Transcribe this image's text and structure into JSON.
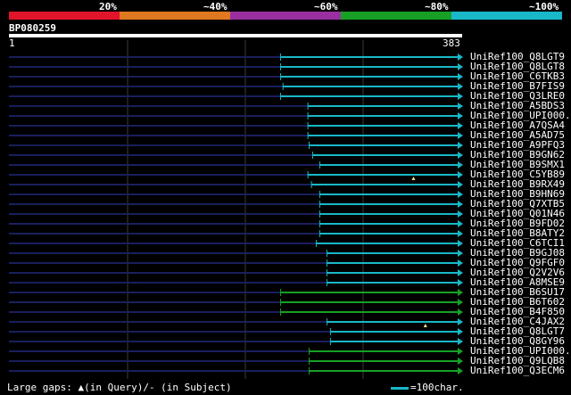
{
  "legend": [
    {
      "label": "20%",
      "color": "#e0142a"
    },
    {
      "label": "~40%",
      "color": "#e07820"
    },
    {
      "label": "~60%",
      "color": "#9a2fa0"
    },
    {
      "label": "~80%",
      "color": "#17a025"
    },
    {
      "label": "~100%",
      "color": "#18b8c8"
    }
  ],
  "query": {
    "name": "BP080259",
    "start": "1",
    "end": "383"
  },
  "hits": [
    {
      "name": "UniRef100_Q8LGT9",
      "start": 230,
      "color": "#18b8c8"
    },
    {
      "name": "UniRef100_Q8LGT8",
      "start": 230,
      "color": "#18b8c8"
    },
    {
      "name": "UniRef100_C6TKB3",
      "start": 230,
      "color": "#18b8c8"
    },
    {
      "name": "UniRef100_B7FIS9",
      "start": 232,
      "color": "#18b8c8"
    },
    {
      "name": "UniRef100_Q3LRE0",
      "start": 230,
      "color": "#18b8c8"
    },
    {
      "name": "UniRef100_A5BDS3",
      "start": 253,
      "color": "#18b8c8"
    },
    {
      "name": "UniRef100_UPI000..",
      "start": 253,
      "color": "#18b8c8"
    },
    {
      "name": "UniRef100_A7QSA4",
      "start": 253,
      "color": "#18b8c8"
    },
    {
      "name": "UniRef100_A5AD75",
      "start": 253,
      "color": "#18b8c8"
    },
    {
      "name": "UniRef100_A9PFQ3",
      "start": 254,
      "color": "#18b8c8"
    },
    {
      "name": "UniRef100_B9GN62",
      "start": 257,
      "color": "#18b8c8"
    },
    {
      "name": "UniRef100_B9SMX1",
      "start": 263,
      "color": "#18b8c8"
    },
    {
      "name": "UniRef100_C5YB89",
      "start": 253,
      "color": "#18b8c8",
      "gap": 342
    },
    {
      "name": "UniRef100_B9RX49",
      "start": 256,
      "color": "#18b8c8"
    },
    {
      "name": "UniRef100_B9HN69",
      "start": 263,
      "color": "#18b8c8"
    },
    {
      "name": "UniRef100_Q7XTB5",
      "start": 263,
      "color": "#18b8c8"
    },
    {
      "name": "UniRef100_Q01N46",
      "start": 263,
      "color": "#18b8c8"
    },
    {
      "name": "UniRef100_B9FD02",
      "start": 263,
      "color": "#18b8c8"
    },
    {
      "name": "UniRef100_B8ATY2",
      "start": 263,
      "color": "#18b8c8"
    },
    {
      "name": "UniRef100_C6TCI1",
      "start": 260,
      "color": "#18b8c8"
    },
    {
      "name": "UniRef100_B9GJ08",
      "start": 269,
      "color": "#18b8c8"
    },
    {
      "name": "UniRef100_Q9FGF0",
      "start": 269,
      "color": "#18b8c8"
    },
    {
      "name": "UniRef100_Q2V2V6",
      "start": 269,
      "color": "#18b8c8"
    },
    {
      "name": "UniRef100_A8MSE9",
      "start": 269,
      "color": "#18b8c8"
    },
    {
      "name": "UniRef100_B6SU17",
      "start": 230,
      "color": "#17a025"
    },
    {
      "name": "UniRef100_B6T602",
      "start": 230,
      "color": "#17a025"
    },
    {
      "name": "UniRef100_B4F850",
      "start": 230,
      "color": "#17a025"
    },
    {
      "name": "UniRef100_C4JAX2",
      "start": 269,
      "color": "#18b8c8",
      "gap": 352
    },
    {
      "name": "UniRef100_Q8LGT7",
      "start": 272,
      "color": "#18b8c8"
    },
    {
      "name": "UniRef100_Q8GY96",
      "start": 272,
      "color": "#18b8c8"
    },
    {
      "name": "UniRef100_UPI000..",
      "start": 254,
      "color": "#17a025"
    },
    {
      "name": "UniRef100_Q9LQB8",
      "start": 254,
      "color": "#17a025"
    },
    {
      "name": "UniRef100_Q3ECM6",
      "start": 254,
      "color": "#17a025"
    }
  ],
  "footer": {
    "gaps_label": "Large gaps: ▲(in Query)/- (in Subject)",
    "scale_label": "=100char."
  }
}
